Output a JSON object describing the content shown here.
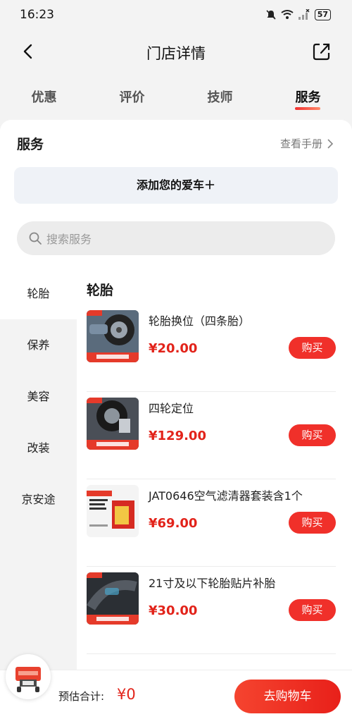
{
  "status_bar": {
    "time": "16:23",
    "battery": "57",
    "icons": [
      "mute-bell-icon",
      "wifi-icon",
      "signal-icon",
      "battery-icon"
    ]
  },
  "nav": {
    "title": "门店详情",
    "back_icon": "chevron-left-icon",
    "share_icon": "share-icon"
  },
  "tabs": [
    {
      "label": "优惠",
      "active": false
    },
    {
      "label": "评价",
      "active": false
    },
    {
      "label": "技师",
      "active": false
    },
    {
      "label": "服务",
      "active": true
    }
  ],
  "services": {
    "title": "服务",
    "manual_link": "查看手册",
    "add_car": "添加您的爱车＋",
    "search_placeholder": "搜索服务"
  },
  "categories": [
    {
      "label": "轮胎",
      "active": true
    },
    {
      "label": "保养",
      "active": false
    },
    {
      "label": "美容",
      "active": false
    },
    {
      "label": "改装",
      "active": false
    },
    {
      "label": "京安途",
      "active": false
    }
  ],
  "category_heading": "轮胎",
  "products": [
    {
      "name": "轮胎换位（四条胎）",
      "price": "¥20.00",
      "buy": "购买",
      "image": "tire-rotation-photo"
    },
    {
      "name": "四轮定位",
      "price": "¥129.00",
      "buy": "购买",
      "image": "wheel-alignment-photo"
    },
    {
      "name": "JAT0646空气滤清器套装含1个",
      "price": "¥69.00",
      "buy": "购买",
      "image": "air-filter-photo"
    },
    {
      "name": "21寸及以下轮胎贴片补胎",
      "price": "¥30.00",
      "buy": "购买",
      "image": "tire-patch-photo"
    }
  ],
  "bottom_bar": {
    "total_label": "预估合计:",
    "total_value": "¥0",
    "checkout": "去购物车"
  },
  "colors": {
    "accent": "#f0302a",
    "price": "#e2231a",
    "sidebar_bg": "#f3f3f3",
    "search_bg": "#ececec",
    "add_car_bg": "#eff2f7"
  }
}
